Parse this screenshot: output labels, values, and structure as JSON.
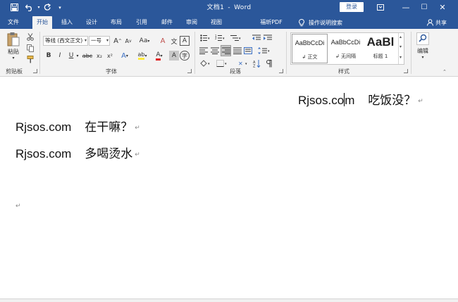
{
  "window": {
    "doc_name": "文档1",
    "separator": "-",
    "app_name": "Word",
    "login_label": "登录",
    "controls": {
      "ribbon_options_icon": "ribbon-display-icon",
      "minimize": "—",
      "maximize": "☐",
      "close": "✕"
    }
  },
  "quick_access": {
    "save_icon": "save-icon",
    "undo_icon": "undo-icon",
    "redo_icon": "redo-icon",
    "customize_icon": "customize-icon"
  },
  "tabs": [
    {
      "label": "文件",
      "active": false
    },
    {
      "label": "开始",
      "active": true
    },
    {
      "label": "插入",
      "active": false
    },
    {
      "label": "设计",
      "active": false
    },
    {
      "label": "布局",
      "active": false
    },
    {
      "label": "引用",
      "active": false
    },
    {
      "label": "邮件",
      "active": false
    },
    {
      "label": "审阅",
      "active": false
    },
    {
      "label": "视图",
      "active": false
    },
    {
      "label": "福昕PDF",
      "active": false
    }
  ],
  "tell_me": "操作说明搜索",
  "share_label": "共享",
  "ribbon": {
    "clipboard": {
      "label": "剪贴板",
      "paste_label": "粘贴"
    },
    "font": {
      "label": "字体",
      "font_name": "等线 (西文正文)",
      "font_size": "一号",
      "grow_font": "A",
      "shrink_font": "A",
      "change_case": "Aa",
      "clear_format": "A",
      "phonetic": "文",
      "char_border": "A",
      "bold": "B",
      "italic": "I",
      "underline": "U",
      "strike": "abc",
      "subscript": "x₂",
      "superscript": "x²",
      "text_effects": "A",
      "highlight": "ab",
      "font_color": "A",
      "char_shading": "A",
      "enclose": "字"
    },
    "paragraph": {
      "label": "段落"
    },
    "styles": {
      "label": "样式",
      "items": [
        {
          "preview": "AaBbCcDi",
          "name": "↲ 正文"
        },
        {
          "preview": "AaBbCcDi",
          "name": "↲ 无间隔"
        },
        {
          "preview": "AaBl",
          "name": "标题 1"
        }
      ]
    },
    "editing": {
      "label": "编辑"
    }
  },
  "document": {
    "line1": {
      "site": "Rjsos.co",
      "after_caret": "m",
      "gap": "    ",
      "text": "吃饭没？",
      "mark": "↵"
    },
    "line2": {
      "site": "Rjsos.com",
      "gap": "    ",
      "text": "在干嘛？",
      "mark": "↵"
    },
    "line3": {
      "site": "Rjsos.com",
      "gap": "    ",
      "text": "多喝烫水",
      "mark": "↵"
    },
    "line4": {
      "mark": "↵"
    }
  }
}
